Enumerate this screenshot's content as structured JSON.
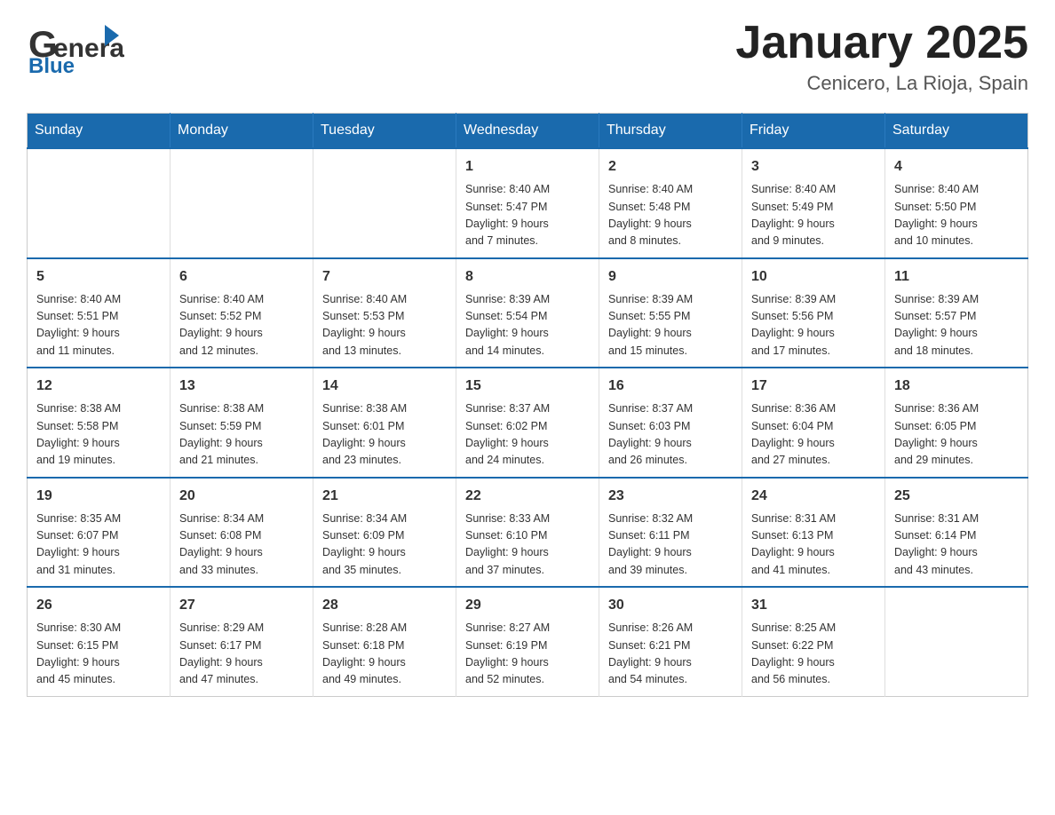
{
  "header": {
    "logo_line1": "General",
    "logo_line2": "Blue",
    "title": "January 2025",
    "subtitle": "Cenicero, La Rioja, Spain"
  },
  "days_of_week": [
    "Sunday",
    "Monday",
    "Tuesday",
    "Wednesday",
    "Thursday",
    "Friday",
    "Saturday"
  ],
  "weeks": [
    [
      {
        "day": "",
        "info": ""
      },
      {
        "day": "",
        "info": ""
      },
      {
        "day": "",
        "info": ""
      },
      {
        "day": "1",
        "info": "Sunrise: 8:40 AM\nSunset: 5:47 PM\nDaylight: 9 hours\nand 7 minutes."
      },
      {
        "day": "2",
        "info": "Sunrise: 8:40 AM\nSunset: 5:48 PM\nDaylight: 9 hours\nand 8 minutes."
      },
      {
        "day": "3",
        "info": "Sunrise: 8:40 AM\nSunset: 5:49 PM\nDaylight: 9 hours\nand 9 minutes."
      },
      {
        "day": "4",
        "info": "Sunrise: 8:40 AM\nSunset: 5:50 PM\nDaylight: 9 hours\nand 10 minutes."
      }
    ],
    [
      {
        "day": "5",
        "info": "Sunrise: 8:40 AM\nSunset: 5:51 PM\nDaylight: 9 hours\nand 11 minutes."
      },
      {
        "day": "6",
        "info": "Sunrise: 8:40 AM\nSunset: 5:52 PM\nDaylight: 9 hours\nand 12 minutes."
      },
      {
        "day": "7",
        "info": "Sunrise: 8:40 AM\nSunset: 5:53 PM\nDaylight: 9 hours\nand 13 minutes."
      },
      {
        "day": "8",
        "info": "Sunrise: 8:39 AM\nSunset: 5:54 PM\nDaylight: 9 hours\nand 14 minutes."
      },
      {
        "day": "9",
        "info": "Sunrise: 8:39 AM\nSunset: 5:55 PM\nDaylight: 9 hours\nand 15 minutes."
      },
      {
        "day": "10",
        "info": "Sunrise: 8:39 AM\nSunset: 5:56 PM\nDaylight: 9 hours\nand 17 minutes."
      },
      {
        "day": "11",
        "info": "Sunrise: 8:39 AM\nSunset: 5:57 PM\nDaylight: 9 hours\nand 18 minutes."
      }
    ],
    [
      {
        "day": "12",
        "info": "Sunrise: 8:38 AM\nSunset: 5:58 PM\nDaylight: 9 hours\nand 19 minutes."
      },
      {
        "day": "13",
        "info": "Sunrise: 8:38 AM\nSunset: 5:59 PM\nDaylight: 9 hours\nand 21 minutes."
      },
      {
        "day": "14",
        "info": "Sunrise: 8:38 AM\nSunset: 6:01 PM\nDaylight: 9 hours\nand 23 minutes."
      },
      {
        "day": "15",
        "info": "Sunrise: 8:37 AM\nSunset: 6:02 PM\nDaylight: 9 hours\nand 24 minutes."
      },
      {
        "day": "16",
        "info": "Sunrise: 8:37 AM\nSunset: 6:03 PM\nDaylight: 9 hours\nand 26 minutes."
      },
      {
        "day": "17",
        "info": "Sunrise: 8:36 AM\nSunset: 6:04 PM\nDaylight: 9 hours\nand 27 minutes."
      },
      {
        "day": "18",
        "info": "Sunrise: 8:36 AM\nSunset: 6:05 PM\nDaylight: 9 hours\nand 29 minutes."
      }
    ],
    [
      {
        "day": "19",
        "info": "Sunrise: 8:35 AM\nSunset: 6:07 PM\nDaylight: 9 hours\nand 31 minutes."
      },
      {
        "day": "20",
        "info": "Sunrise: 8:34 AM\nSunset: 6:08 PM\nDaylight: 9 hours\nand 33 minutes."
      },
      {
        "day": "21",
        "info": "Sunrise: 8:34 AM\nSunset: 6:09 PM\nDaylight: 9 hours\nand 35 minutes."
      },
      {
        "day": "22",
        "info": "Sunrise: 8:33 AM\nSunset: 6:10 PM\nDaylight: 9 hours\nand 37 minutes."
      },
      {
        "day": "23",
        "info": "Sunrise: 8:32 AM\nSunset: 6:11 PM\nDaylight: 9 hours\nand 39 minutes."
      },
      {
        "day": "24",
        "info": "Sunrise: 8:31 AM\nSunset: 6:13 PM\nDaylight: 9 hours\nand 41 minutes."
      },
      {
        "day": "25",
        "info": "Sunrise: 8:31 AM\nSunset: 6:14 PM\nDaylight: 9 hours\nand 43 minutes."
      }
    ],
    [
      {
        "day": "26",
        "info": "Sunrise: 8:30 AM\nSunset: 6:15 PM\nDaylight: 9 hours\nand 45 minutes."
      },
      {
        "day": "27",
        "info": "Sunrise: 8:29 AM\nSunset: 6:17 PM\nDaylight: 9 hours\nand 47 minutes."
      },
      {
        "day": "28",
        "info": "Sunrise: 8:28 AM\nSunset: 6:18 PM\nDaylight: 9 hours\nand 49 minutes."
      },
      {
        "day": "29",
        "info": "Sunrise: 8:27 AM\nSunset: 6:19 PM\nDaylight: 9 hours\nand 52 minutes."
      },
      {
        "day": "30",
        "info": "Sunrise: 8:26 AM\nSunset: 6:21 PM\nDaylight: 9 hours\nand 54 minutes."
      },
      {
        "day": "31",
        "info": "Sunrise: 8:25 AM\nSunset: 6:22 PM\nDaylight: 9 hours\nand 56 minutes."
      },
      {
        "day": "",
        "info": ""
      }
    ]
  ]
}
